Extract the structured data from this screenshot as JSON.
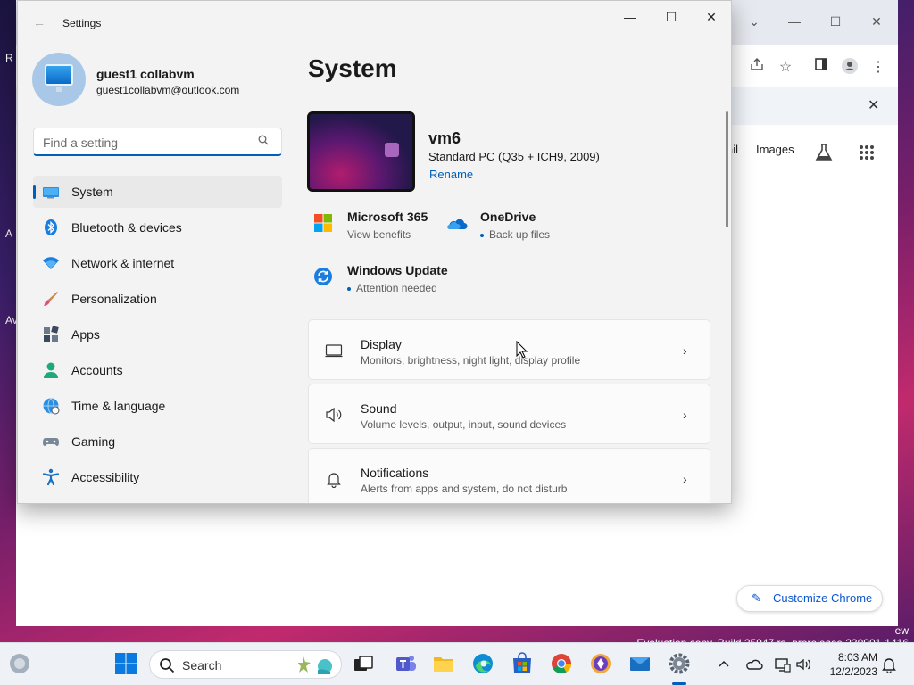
{
  "settings": {
    "app_title": "Settings",
    "user": {
      "name": "guest1 collabvm",
      "email": "guest1collabvm@outlook.com"
    },
    "search": {
      "placeholder": "Find a setting"
    },
    "nav": [
      {
        "label": "System",
        "icon": "monitor-icon",
        "active": true
      },
      {
        "label": "Bluetooth & devices",
        "icon": "bluetooth-icon"
      },
      {
        "label": "Network & internet",
        "icon": "wifi-icon"
      },
      {
        "label": "Personalization",
        "icon": "brush-icon"
      },
      {
        "label": "Apps",
        "icon": "apps-icon"
      },
      {
        "label": "Accounts",
        "icon": "person-icon"
      },
      {
        "label": "Time & language",
        "icon": "globe-clock-icon"
      },
      {
        "label": "Gaming",
        "icon": "gamepad-icon"
      },
      {
        "label": "Accessibility",
        "icon": "accessibility-icon"
      }
    ],
    "page_title": "System",
    "device": {
      "name": "vm6",
      "model": "Standard PC (Q35 + ICH9, 2009)",
      "rename_label": "Rename"
    },
    "quick": [
      {
        "title": "Microsoft 365",
        "subtitle": "View benefits",
        "icon": "microsoft-logo-icon"
      },
      {
        "title": "OneDrive",
        "subtitle": "Back up files",
        "icon": "onedrive-cloud-icon"
      },
      {
        "title": "Windows Update",
        "subtitle": "Attention needed",
        "icon": "windows-update-icon"
      }
    ],
    "cards": [
      {
        "title": "Display",
        "subtitle": "Monitors, brightness, night light, display profile",
        "icon": "display-icon"
      },
      {
        "title": "Sound",
        "subtitle": "Volume levels, output, input, sound devices",
        "icon": "speaker-icon"
      },
      {
        "title": "Notifications",
        "subtitle": "Alerts from apps and system, do not disturb",
        "icon": "bell-icon"
      }
    ]
  },
  "chrome": {
    "nav_links": {
      "mail": "ail",
      "images": "Images"
    },
    "customize_label": "Customize Chrome"
  },
  "desktop": {
    "frag1": "R",
    "frag2": "A",
    "frag3": "Av"
  },
  "watermark": {
    "line1": "ew",
    "line2": "Evaluation copy. Build 25947.rs_prerelease.230901-1416"
  },
  "taskbar": {
    "search_label": "Search",
    "time": "8:03 AM",
    "date": "12/2/2023"
  },
  "colors": {
    "accent": "#005fb8",
    "wallpaper_pink": "#c12a6d"
  }
}
